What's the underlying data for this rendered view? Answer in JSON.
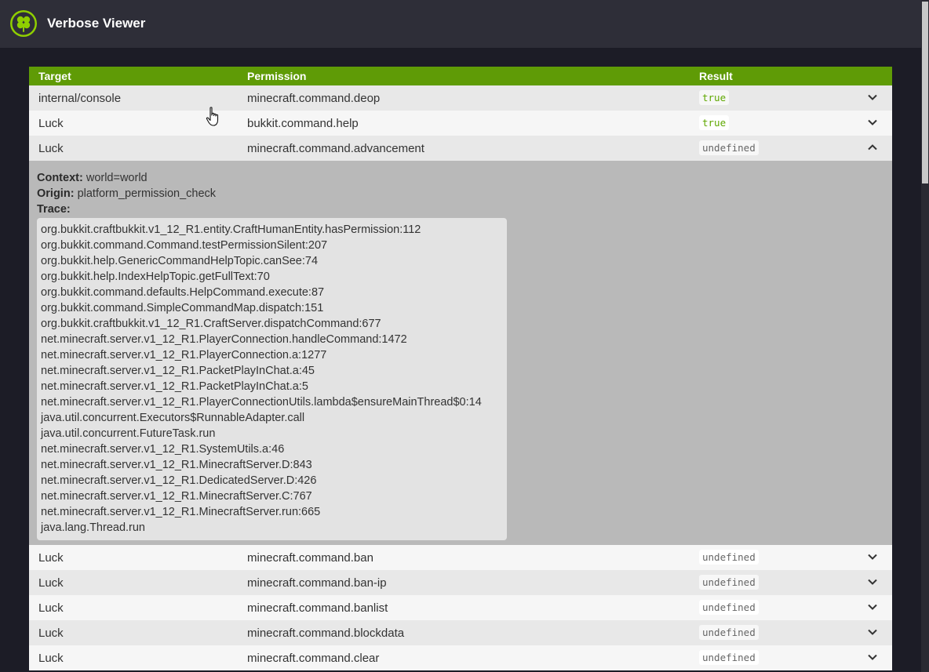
{
  "app": {
    "title": "Verbose Viewer",
    "logo_icon": "clover-logo-icon",
    "accent": "#8fce00"
  },
  "table": {
    "headers": {
      "target": "Target",
      "permission": "Permission",
      "result": "Result"
    },
    "header_color": "#5f9b06",
    "rows_top": [
      {
        "target": "internal/console",
        "permission": "minecraft.command.deop",
        "result": "true"
      },
      {
        "target": "Luck",
        "permission": "bukkit.command.help",
        "result": "true"
      },
      {
        "target": "Luck",
        "permission": "minecraft.command.advancement",
        "result": "undefined"
      }
    ],
    "expanded": {
      "context_label": "Context:",
      "context_value": "world=world",
      "origin_label": "Origin:",
      "origin_value": "platform_permission_check",
      "trace_label": "Trace:",
      "trace": [
        "org.bukkit.craftbukkit.v1_12_R1.entity.CraftHumanEntity.hasPermission:112",
        "org.bukkit.command.Command.testPermissionSilent:207",
        "org.bukkit.help.GenericCommandHelpTopic.canSee:74",
        "org.bukkit.help.IndexHelpTopic.getFullText:70",
        "org.bukkit.command.defaults.HelpCommand.execute:87",
        "org.bukkit.command.SimpleCommandMap.dispatch:151",
        "org.bukkit.craftbukkit.v1_12_R1.CraftServer.dispatchCommand:677",
        "net.minecraft.server.v1_12_R1.PlayerConnection.handleCommand:1472",
        "net.minecraft.server.v1_12_R1.PlayerConnection.a:1277",
        "net.minecraft.server.v1_12_R1.PacketPlayInChat.a:45",
        "net.minecraft.server.v1_12_R1.PacketPlayInChat.a:5",
        "net.minecraft.server.v1_12_R1.PlayerConnectionUtils.lambda$ensureMainThread$0:14",
        "java.util.concurrent.Executors$RunnableAdapter.call",
        "java.util.concurrent.FutureTask.run",
        "net.minecraft.server.v1_12_R1.SystemUtils.a:46",
        "net.minecraft.server.v1_12_R1.MinecraftServer.D:843",
        "net.minecraft.server.v1_12_R1.DedicatedServer.D:426",
        "net.minecraft.server.v1_12_R1.MinecraftServer.C:767",
        "net.minecraft.server.v1_12_R1.MinecraftServer.run:665",
        "java.lang.Thread.run"
      ]
    },
    "rows_bottom": [
      {
        "target": "Luck",
        "permission": "minecraft.command.ban",
        "result": "undefined"
      },
      {
        "target": "Luck",
        "permission": "minecraft.command.ban-ip",
        "result": "undefined"
      },
      {
        "target": "Luck",
        "permission": "minecraft.command.banlist",
        "result": "undefined"
      },
      {
        "target": "Luck",
        "permission": "minecraft.command.blockdata",
        "result": "undefined"
      },
      {
        "target": "Luck",
        "permission": "minecraft.command.clear",
        "result": "undefined"
      }
    ]
  }
}
